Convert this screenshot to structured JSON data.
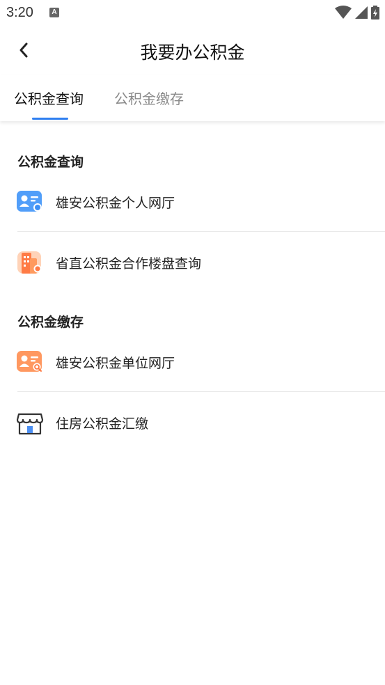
{
  "status": {
    "time": "3:20",
    "a_icon": "A"
  },
  "nav": {
    "title": "我要办公积金"
  },
  "tabs": [
    {
      "label": "公积金查询",
      "active": true
    },
    {
      "label": "公积金缴存",
      "active": false
    }
  ],
  "sections": [
    {
      "title": "公积金查询",
      "items": [
        {
          "label": "雄安公积金个人网厅",
          "icon": "personal-id-card-icon"
        },
        {
          "label": "省直公积金合作楼盘查询",
          "icon": "building-icon"
        }
      ]
    },
    {
      "title": "公积金缴存",
      "items": [
        {
          "label": "雄安公积金单位网厅",
          "icon": "unit-search-card-icon"
        },
        {
          "label": "住房公积金汇缴",
          "icon": "store-icon"
        }
      ]
    }
  ],
  "colors": {
    "accent": "#2f7ff0",
    "inactive_tab": "#8a8a8a"
  }
}
